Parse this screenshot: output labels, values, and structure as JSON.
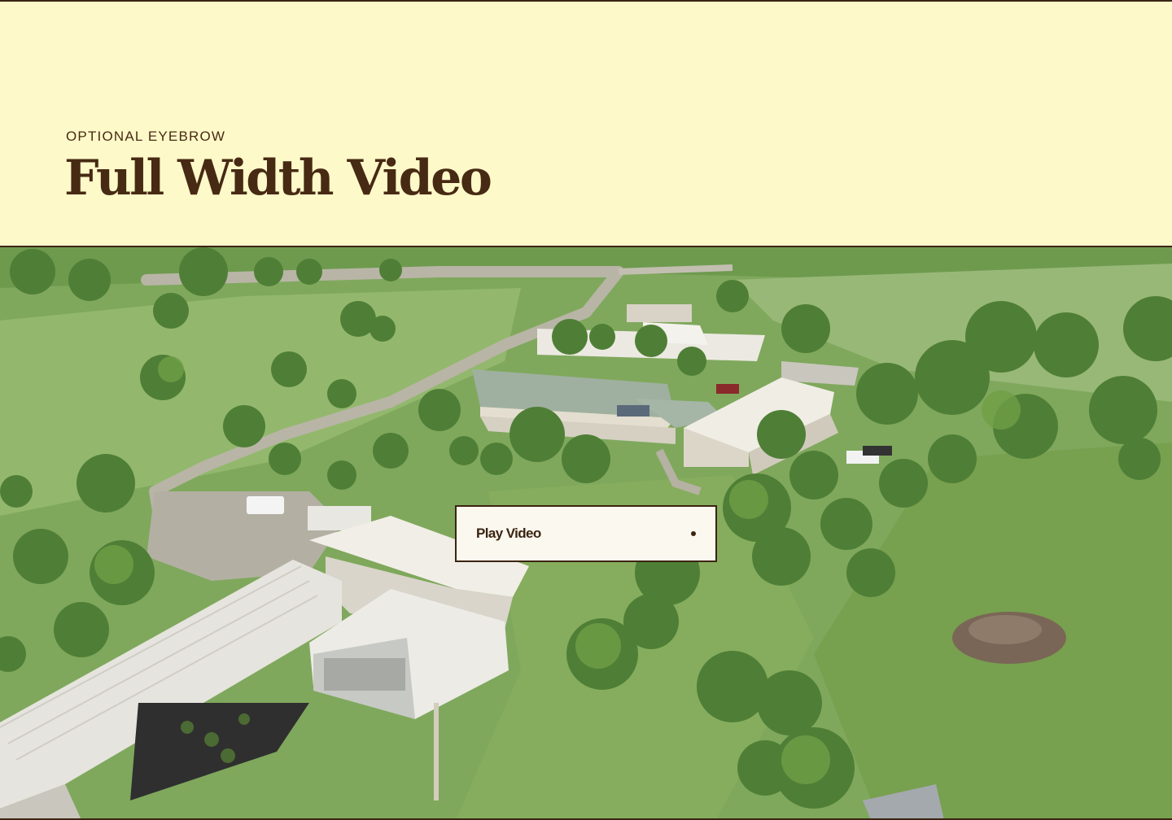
{
  "hero": {
    "eyebrow": "OPTIONAL EYEBROW",
    "title": "Full Width Video"
  },
  "video": {
    "play_label": "Play Video",
    "play_icon": "dot-icon",
    "poster_subject": "aerial-campus-greenhouse-scene"
  },
  "colors": {
    "header_bg": "#fef9c9",
    "text": "#472a13",
    "border": "#3b2412",
    "button_bg": "#fbf8ef"
  }
}
